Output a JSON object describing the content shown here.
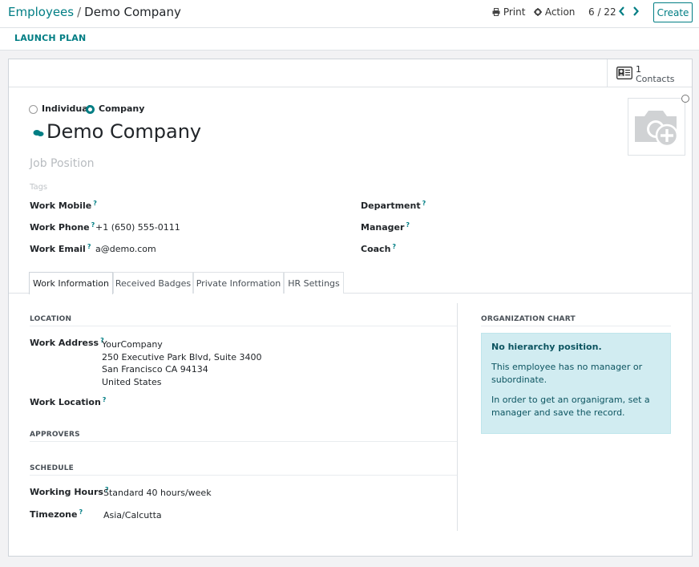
{
  "breadcrumb": {
    "parent": "Employees",
    "separator": "/",
    "current": "Demo Company"
  },
  "toolbar": {
    "print_label": "Print",
    "action_label": "Action",
    "pager": "6 / 22",
    "create_label": "Create"
  },
  "statusbar": {
    "launch_plan_label": "LAUNCH PLAN"
  },
  "smart_button": {
    "count": "1",
    "label": "Contacts",
    "icon": "contact-card-icon"
  },
  "type_toggle": {
    "individual_label": "Individual",
    "company_label": "Company",
    "selected": "Company"
  },
  "employee": {
    "name": "Demo Company",
    "job_position_placeholder": "Job Position",
    "tags_placeholder": "Tags"
  },
  "fields_left": [
    {
      "label": "Work Mobile",
      "help": "?",
      "value": ""
    },
    {
      "label": "Work Phone",
      "help": "?",
      "value": "+1 (650) 555-0111"
    },
    {
      "label": "Work Email",
      "help": "?",
      "value": "a@demo.com"
    }
  ],
  "fields_right": [
    {
      "label": "Department",
      "help": "?",
      "value": ""
    },
    {
      "label": "Manager",
      "help": "?",
      "value": ""
    },
    {
      "label": "Coach",
      "help": "?",
      "value": ""
    }
  ],
  "tabs": [
    "Work Information",
    "Received Badges",
    "Private Information",
    "HR Settings"
  ],
  "active_tab": "Work Information",
  "location": {
    "title": "LOCATION",
    "work_address_label": "Work Address",
    "work_address_lines": [
      "YourCompany",
      "250 Executive Park Blvd, Suite 3400",
      "San Francisco CA 94134",
      "United States"
    ],
    "work_location_label": "Work Location",
    "help": "?"
  },
  "approvers": {
    "title": "APPROVERS"
  },
  "schedule": {
    "title": "SCHEDULE",
    "working_hours_label": "Working Hours",
    "working_hours_value": "Standard 40 hours/week",
    "timezone_label": "Timezone",
    "timezone_value": "Asia/Calcutta",
    "help": "?"
  },
  "org_chart": {
    "title": "ORGANIZATION CHART",
    "alert_title": "No hierarchy position.",
    "alert_line1": "This employee has no manager or subordinate.",
    "alert_line2": "In order to get an organigram, set a manager and save the record."
  },
  "colors": {
    "accent": "#017e84",
    "alert_bg": "#d1ecf1",
    "alert_text": "#0c5460"
  }
}
